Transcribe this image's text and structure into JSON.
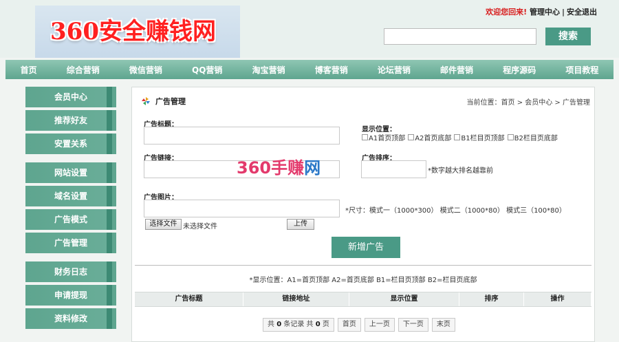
{
  "header": {
    "logo_text": "360安全赚钱网",
    "welcome": "欢迎您回来!",
    "link_member_center": "管理中心",
    "link_logout": "安全退出",
    "search_placeholder": "",
    "search_button": "搜索"
  },
  "nav": {
    "items": [
      "首页",
      "综合营销",
      "微信营销",
      "QQ营销",
      "淘宝营销",
      "博客营销",
      "论坛营销",
      "邮件营销",
      "程序源码",
      "项目教程"
    ]
  },
  "sidebar": {
    "items": [
      "会员中心",
      "推荐好友",
      "安置关系",
      "网站设置",
      "域名设置",
      "广告模式",
      "广告管理",
      "财务日志",
      "申请提现",
      "资料修改"
    ]
  },
  "panel": {
    "title": "广告管理",
    "breadcrumb": "当前位置：首页 > 会员中心 > 广告管理"
  },
  "form": {
    "ad_title_label": "广告标题：",
    "ad_title_value": "",
    "ad_link_label": "广告链接：",
    "ad_link_value": "",
    "ad_image_label": "广告图片：",
    "ad_image_value": "",
    "position_label": "显示位置：",
    "position_options": [
      "A1首页顶部",
      "A2首页底部",
      "B1栏目页顶部",
      "B2栏目页底部"
    ],
    "sort_label": "广告排序：",
    "sort_value": "",
    "sort_hint": "*数字越大排名越靠前",
    "size_hint": "*尺寸：模式一（1000*300） 模式二（1000*80） 模式三（100*80）",
    "choose_file_button": "选择文件",
    "no_file_text": "未选择文件",
    "upload_button": "上传",
    "submit_button": "新增广告"
  },
  "watermark": {
    "part1": "360手赚",
    "part2": "网"
  },
  "table": {
    "legend": "*显示位置：A1=首页顶部 A2=首页底部 B1=栏目页顶部 B2=栏目页底部",
    "columns": [
      "广告标题",
      "链接地址",
      "显示位置",
      "排序",
      "操作"
    ]
  },
  "pager": {
    "summary_prefix": "共",
    "record_count": "0",
    "summary_mid": "条记录 共",
    "page_count": "0",
    "summary_suffix": "页",
    "first": "首页",
    "prev": "上一页",
    "next": "下一页",
    "last": "末页"
  },
  "colors": {
    "accent": "#4a9a86",
    "nav_gradient_top": "#8fc6b3",
    "welcome_red": "#d81e1e"
  }
}
